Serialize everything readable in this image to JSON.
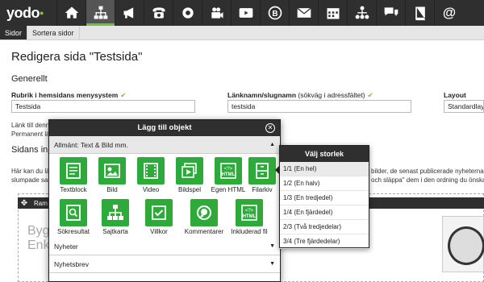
{
  "app": {
    "logo": "yodo"
  },
  "nav": {
    "icons": [
      "home-icon",
      "sitemap-icon",
      "megaphone-icon",
      "phone-icon",
      "gear-badge-icon",
      "video-camera-icon",
      "play-icon",
      "b-circle-icon",
      "mail-icon",
      "calendar-icon",
      "network-icon",
      "chat-icon",
      "book-icon",
      "at-icon"
    ]
  },
  "subtabs": [
    "Sidor",
    "Sortera sidor"
  ],
  "page": {
    "title": "Redigera sida \"Testsida\"",
    "section_general": "Generellt",
    "menu_label": "Rubrik i hemsidans menysystem",
    "menu_value": "Testsida",
    "slug_label": "Länknamn/slugnamn",
    "slug_hint": "(sökväg i adressfältet)",
    "slug_value": "testsida",
    "layout_label": "Layout",
    "layout_value": "Standardlayo",
    "link_text_1": "Länk till denn",
    "link_text_2": "Permanent lä",
    "section_content": "Sidans inne",
    "desc_left_1": "Här kan du lä",
    "desc_left_2": "slumpade sam",
    "desc_right_1": "bilder, de senast publicerade nyheterna,",
    "desc_right_2": "och släppa\" dem i den ordning du önska",
    "ram_label": "Ram",
    "ghost_text_1": "Byg",
    "ghost_text_2": "Enk"
  },
  "dialog": {
    "title": "Lägg till objekt",
    "close_glyph": "✕",
    "categories": [
      {
        "label": "Allmänt: Text & Bild mm.",
        "caret": "▲"
      },
      {
        "label": "Nyheter",
        "caret": "▼"
      },
      {
        "label": "Nyhetsbrev",
        "caret": "▼"
      }
    ],
    "items": [
      {
        "label": "Textblock",
        "icon": "textblock-icon"
      },
      {
        "label": "Bild",
        "icon": "image-icon"
      },
      {
        "label": "Video",
        "icon": "film-icon"
      },
      {
        "label": "Bildspel",
        "icon": "slideshow-icon"
      },
      {
        "label": "Egen HTML",
        "icon": "html-icon"
      },
      {
        "label": "Filarkiv",
        "icon": "file-cabinet-icon"
      },
      {
        "label": "Sökresultat",
        "icon": "search-result-icon"
      },
      {
        "label": "Sajtkarta",
        "icon": "sitemap-tree-icon"
      },
      {
        "label": "Villkor",
        "icon": "checkbox-icon"
      },
      {
        "label": "Kommentarer",
        "icon": "comment-icon"
      },
      {
        "label": "Inkluderad fil",
        "icon": "include-html-icon"
      }
    ],
    "html_tag": "<?>",
    "html_text": "HTML"
  },
  "size_popup": {
    "title": "Välj storlek",
    "options": [
      "1/1 (En hel)",
      "1/2 (En halv)",
      "1/3 (En tredjedel)",
      "1/4 (En fjärdedel)",
      "2/3 (Två tredjedelar)",
      "3/4 (Tre fjärdedelar)"
    ],
    "selected_index": 0
  },
  "colors": {
    "green": "#2eaa3a",
    "check": "#7cbd2f",
    "dark": "#2f2f2f"
  }
}
